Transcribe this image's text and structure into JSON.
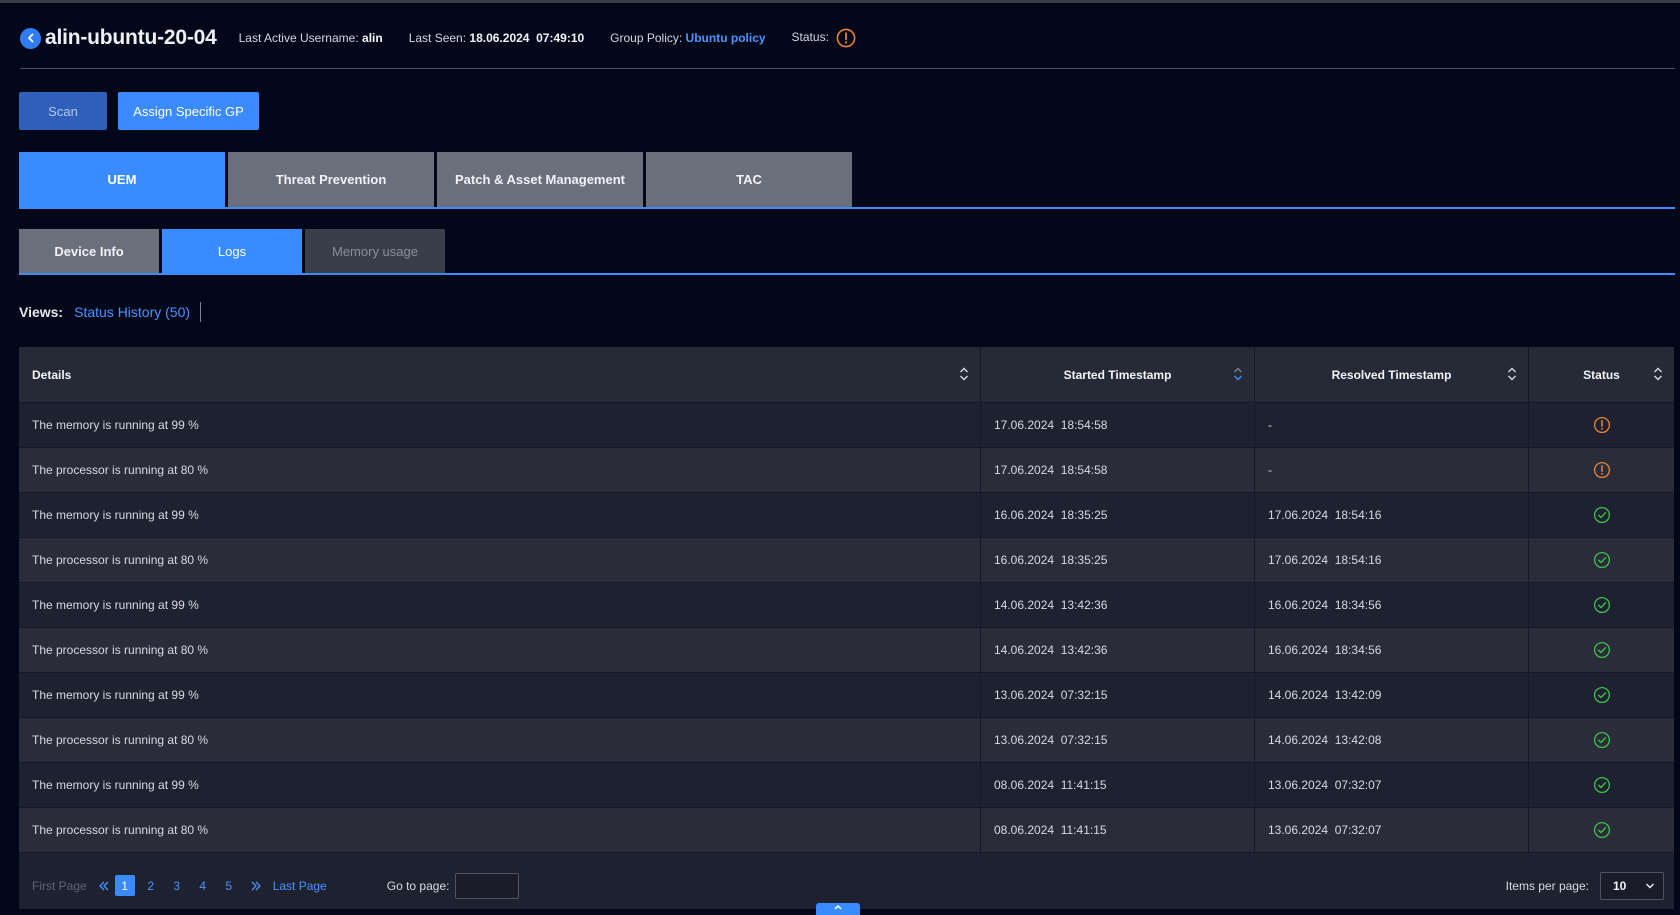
{
  "header": {
    "device_name": "alin-ubuntu-20-04",
    "last_active_label": "Last Active Username:",
    "last_active_value": "alin",
    "last_seen_label": "Last Seen:",
    "last_seen_value": "18.06.2024  07:49:10",
    "group_policy_label": "Group Policy:",
    "group_policy_value": "Ubuntu policy",
    "status_label": "Status:",
    "status_icon": "warning-circle-icon",
    "colors": {
      "accent": "#3a8bff",
      "warning": "#e8823a",
      "ok": "#3fbf4a",
      "background": "#03071a"
    }
  },
  "actions": {
    "scan_label": "Scan",
    "assign_label": "Assign Specific GP"
  },
  "main_tabs": [
    {
      "label": "UEM",
      "active": true
    },
    {
      "label": "Threat Prevention",
      "active": false
    },
    {
      "label": "Patch & Asset Management",
      "active": false
    },
    {
      "label": "TAC",
      "active": false
    }
  ],
  "sub_tabs": [
    {
      "label": "Device Info",
      "state": "normal"
    },
    {
      "label": "Logs",
      "state": "active"
    },
    {
      "label": "Memory usage",
      "state": "disabled"
    }
  ],
  "views": {
    "label": "Views:",
    "link": "Status History (50)"
  },
  "table": {
    "columns": [
      "Details",
      "Started Timestamp",
      "Resolved Timestamp",
      "Status"
    ],
    "rows": [
      {
        "details": "The memory is running at 99 %",
        "started": "17.06.2024  18:54:58",
        "resolved": "-",
        "status": "warning"
      },
      {
        "details": "The processor is running at 80 %",
        "started": "17.06.2024  18:54:58",
        "resolved": "-",
        "status": "warning"
      },
      {
        "details": "The memory is running at 99 %",
        "started": "16.06.2024  18:35:25",
        "resolved": "17.06.2024  18:54:16",
        "status": "resolved"
      },
      {
        "details": "The processor is running at 80 %",
        "started": "16.06.2024  18:35:25",
        "resolved": "17.06.2024  18:54:16",
        "status": "resolved"
      },
      {
        "details": "The memory is running at 99 %",
        "started": "14.06.2024  13:42:36",
        "resolved": "16.06.2024  18:34:56",
        "status": "resolved"
      },
      {
        "details": "The processor is running at 80 %",
        "started": "14.06.2024  13:42:36",
        "resolved": "16.06.2024  18:34:56",
        "status": "resolved"
      },
      {
        "details": "The memory is running at 99 %",
        "started": "13.06.2024  07:32:15",
        "resolved": "14.06.2024  13:42:09",
        "status": "resolved"
      },
      {
        "details": "The processor is running at 80 %",
        "started": "13.06.2024  07:32:15",
        "resolved": "14.06.2024  13:42:08",
        "status": "resolved"
      },
      {
        "details": "The memory is running at 99 %",
        "started": "08.06.2024  11:41:15",
        "resolved": "13.06.2024  07:32:07",
        "status": "resolved"
      },
      {
        "details": "The processor is running at 80 %",
        "started": "08.06.2024  11:41:15",
        "resolved": "13.06.2024  07:32:07",
        "status": "resolved"
      }
    ]
  },
  "pagination": {
    "first_label": "First Page",
    "pages": [
      "1",
      "2",
      "3",
      "4",
      "5"
    ],
    "current_page": "1",
    "last_label": "Last Page",
    "goto_label": "Go to page:",
    "goto_value": "",
    "items_per_page_label": "Items per page:",
    "items_per_page_value": "10"
  }
}
